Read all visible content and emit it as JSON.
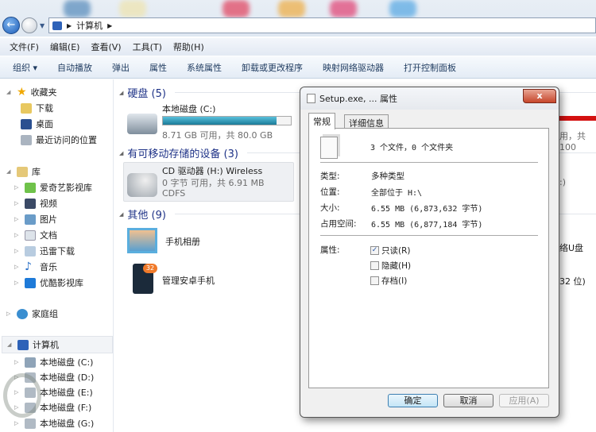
{
  "address": {
    "path": [
      "计算机"
    ]
  },
  "menu": [
    "文件(F)",
    "编辑(E)",
    "查看(V)",
    "工具(T)",
    "帮助(H)"
  ],
  "toolbar": [
    "组织 ▾",
    "自动播放",
    "弹出",
    "属性",
    "系统属性",
    "卸载或更改程序",
    "映射网络驱动器",
    "打开控制面板"
  ],
  "nav": {
    "favorites": {
      "label": "收藏夹",
      "items": [
        "下载",
        "桌面",
        "最近访问的位置"
      ]
    },
    "libraries": {
      "label": "库",
      "items": [
        "爱奇艺影视库",
        "视频",
        "图片",
        "文档",
        "迅雷下载",
        "音乐",
        "优酷影视库"
      ]
    },
    "homegroup": "家庭组",
    "computer": {
      "label": "计算机",
      "items": [
        "本地磁盘 (C:)",
        "本地磁盘 (D:)",
        "本地磁盘 (E:)",
        "本地磁盘 (F:)",
        "本地磁盘 (G:)"
      ]
    }
  },
  "content": {
    "hdd": {
      "header": "硬盘 (5)",
      "drive": {
        "name": "本地磁盘 (C:)",
        "free": "8.71 GB 可用，共 80.0 GB",
        "used_fraction": 0.89
      }
    },
    "removable": {
      "header": "有可移动存储的设备 (3)",
      "drive": {
        "name": "CD 驱动器 (H:) Wireless",
        "free": "0 字节 可用，共 6.91 MB",
        "fs": "CDFS"
      }
    },
    "other": {
      "header": "其他 (9)",
      "items": [
        "手机相册",
        "管理安卓手机"
      ],
      "badge": "32"
    },
    "obscured": [
      "用，共 100",
      ":)",
      "络U盘",
      "32 位)"
    ]
  },
  "dialog": {
    "title": "Setup.exe, ... 属性",
    "close": "x",
    "tabs": [
      "常规",
      "详细信息"
    ],
    "summary": "3 个文件，0 个文件夹",
    "fields": [
      {
        "k": "类型:",
        "v": "多种类型"
      },
      {
        "k": "位置:",
        "v": "全部位于 H:\\"
      },
      {
        "k": "大小:",
        "v": "6.55 MB (6,873,632 字节)"
      },
      {
        "k": "占用空间:",
        "v": "6.55 MB (6,877,184 字节)"
      }
    ],
    "attr_label": "属性:",
    "attrs": [
      {
        "label": "只读(R)",
        "checked": true
      },
      {
        "label": "隐藏(H)",
        "checked": false
      },
      {
        "label": "存档(I)",
        "checked": false
      }
    ],
    "buttons": {
      "ok": "确定",
      "cancel": "取消",
      "apply": "应用(A)"
    }
  }
}
